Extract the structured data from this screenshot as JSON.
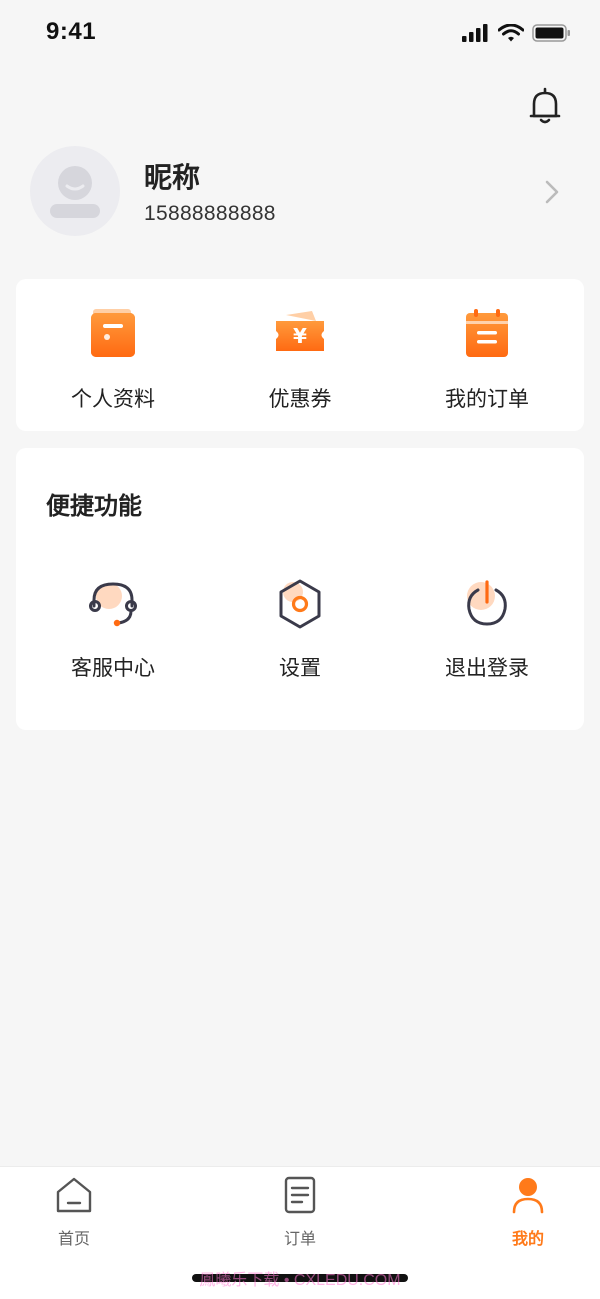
{
  "status_bar": {
    "time": "9:41"
  },
  "profile": {
    "nickname": "昵称",
    "phone": "15888888888"
  },
  "shortcuts": [
    {
      "label": "个人资料",
      "icon": "profile-card-icon"
    },
    {
      "label": "优惠券",
      "icon": "coupon-icon"
    },
    {
      "label": "我的订单",
      "icon": "order-calendar-icon"
    }
  ],
  "quick_functions": {
    "title": "便捷功能",
    "items": [
      {
        "label": "客服中心",
        "icon": "headset-icon"
      },
      {
        "label": "设置",
        "icon": "settings-hexagon-icon"
      },
      {
        "label": "退出登录",
        "icon": "power-icon"
      }
    ]
  },
  "tabbar": {
    "items": [
      {
        "label": "首页",
        "icon": "home-icon",
        "active": false
      },
      {
        "label": "订单",
        "icon": "document-icon",
        "active": false
      },
      {
        "label": "我的",
        "icon": "person-icon",
        "active": true
      }
    ]
  },
  "watermark": "鳳曦乐下载 • CXLEDU.COM",
  "colors": {
    "accent": "#ff7a1a",
    "background": "#f6f6f6",
    "card": "#ffffff"
  }
}
